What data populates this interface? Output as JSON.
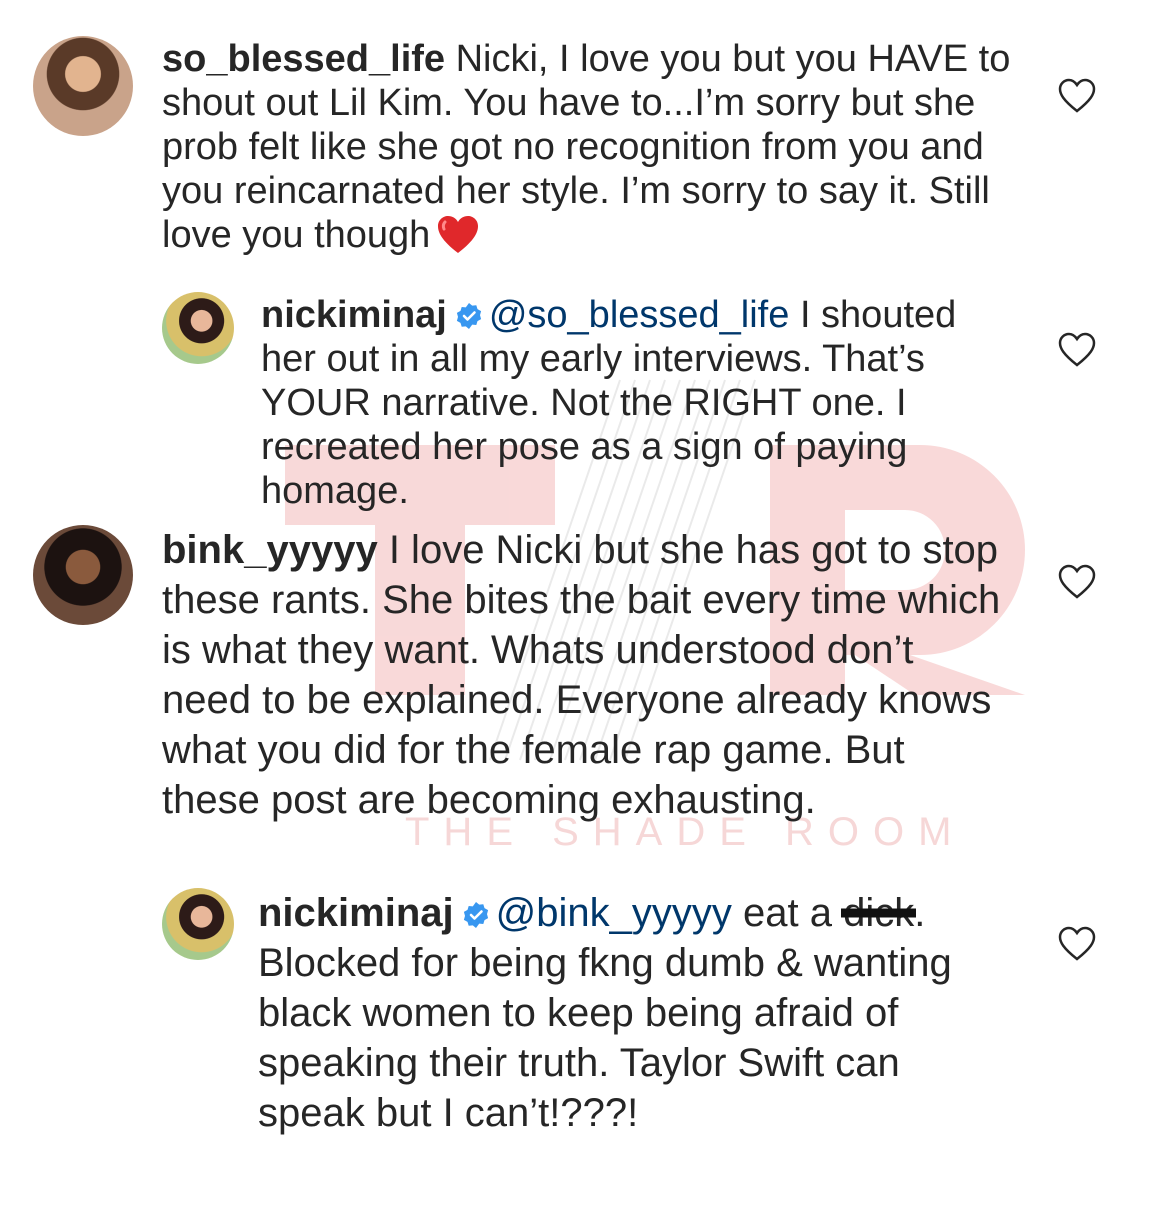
{
  "watermark": {
    "letters": "TSR",
    "caption": "THE SHADE ROOM"
  },
  "colors": {
    "text": "#262626",
    "mention": "#00376b",
    "verified": "#3897f0",
    "heart_emoji": "#e0282b",
    "watermark": "#f6c9c9"
  },
  "comments": [
    {
      "username": "so_blessed_life",
      "text": "Nicki, I love you but you HAVE to shout out Lil Kim. You have to...I’m sorry but she prob felt like she got no recognition from you and you reincarnated her style. I’m sorry to say it. Still love you though",
      "emoji": "red-heart",
      "like_icon": "heart-outline-icon"
    },
    {
      "username": "nickiminaj",
      "verified": true,
      "mention": "@so_blessed_life",
      "text": "I shouted her out in all my early interviews. That’s YOUR narrative. Not the RIGHT one. I recreated her pose as a sign of paying homage.",
      "like_icon": "heart-outline-icon"
    },
    {
      "username": "bink_yyyyy",
      "text": "I love Nicki but she has got to stop these rants. She bites the bait every time which is what they want. Whats understood don’t need to be explained. Everyone already knows what you did for the female rap game. But these post are becoming exhausting.",
      "like_icon": "heart-outline-icon"
    },
    {
      "username": "nickiminaj",
      "verified": true,
      "mention": "@bink_yyyyy",
      "text_before": "eat a",
      "redacted": "dick",
      "text_after": ". Blocked for being fkng dumb & wanting black women to keep being afraid of speaking their truth. Taylor Swift can speak but I can’t!???!",
      "like_icon": "heart-outline-icon"
    }
  ]
}
